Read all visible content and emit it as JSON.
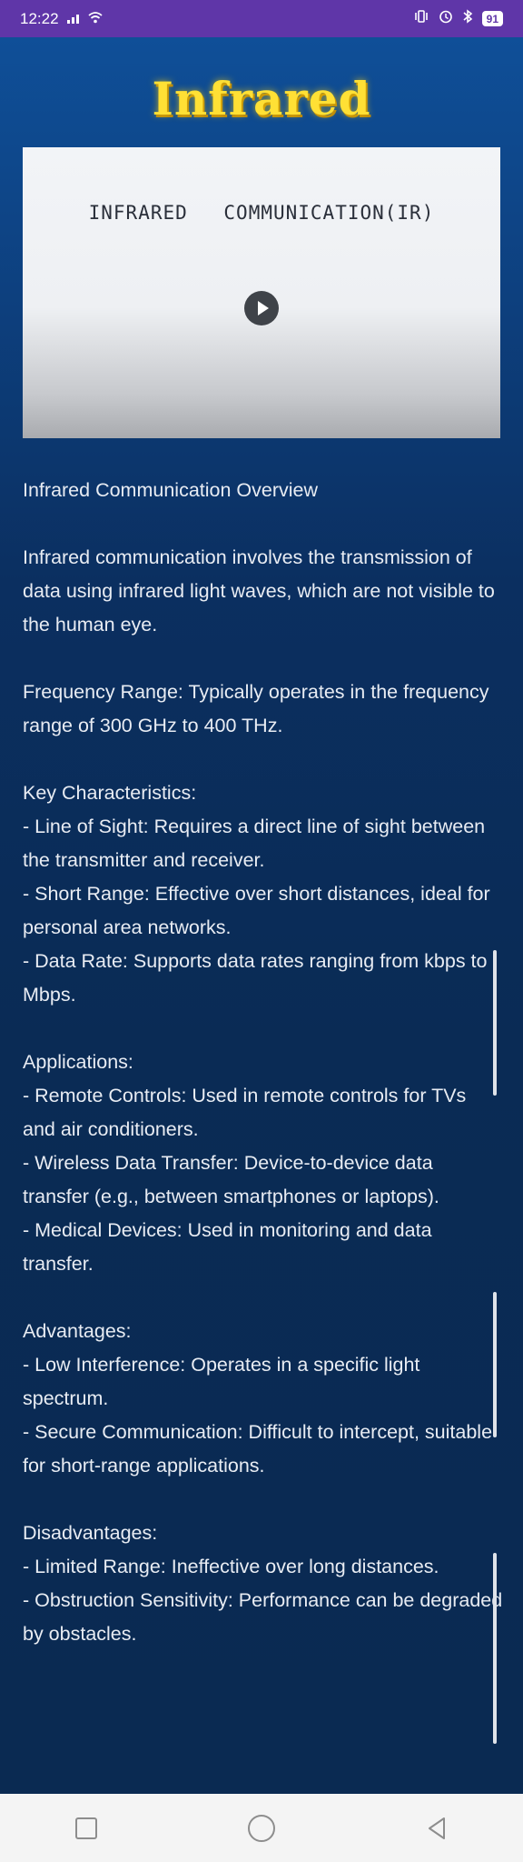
{
  "status_bar": {
    "time": "12:22",
    "battery": "91"
  },
  "page": {
    "title": "Infrared"
  },
  "video": {
    "caption_text": "INFRARED COMMUNICATION(IR)"
  },
  "article": {
    "heading": "Infrared Communication Overview",
    "intro": "Infrared communication involves the transmission of data using infrared light waves, which are not visible to the human eye.",
    "frequency": "Frequency Range: Typically operates in the frequency range of 300 GHz to 400 THz.",
    "characteristics": {
      "heading": "Key Characteristics:",
      "items": [
        "- Line of Sight: Requires a direct line of sight between the transmitter and receiver.",
        "- Short Range: Effective over short distances, ideal for personal area networks.",
        "- Data Rate: Supports data rates ranging from kbps to Mbps."
      ]
    },
    "applications": {
      "heading": "Applications:",
      "items": [
        "- Remote Controls: Used in remote controls for TVs and air conditioners.",
        "- Wireless Data Transfer: Device-to-device data transfer (e.g., between smartphones or laptops).",
        "- Medical Devices: Used in monitoring and data transfer."
      ]
    },
    "advantages": {
      "heading": "Advantages:",
      "items": [
        "- Low Interference: Operates in a specific light spectrum.",
        "- Secure Communication: Difficult to intercept, suitable for short-range applications."
      ]
    },
    "disadvantages": {
      "heading": "Disadvantages:",
      "items": [
        "- Limited Range: Ineffective over long distances.",
        "- Obstruction Sensitivity: Performance can be degraded by obstacles."
      ]
    }
  },
  "icons": {
    "signal": "signal-icon",
    "wifi": "wifi-icon",
    "vibrate": "vibrate-icon",
    "alarm": "alarm-icon",
    "bluetooth": "bluetooth-icon",
    "play": "play-icon",
    "nav_recents": "recents-icon",
    "nav_home": "home-icon",
    "nav_back": "back-icon"
  },
  "colors": {
    "status_bar": "#5f36a8",
    "title": "#ffe035",
    "background": "#0b2f60",
    "text": "#e8ecf3"
  }
}
